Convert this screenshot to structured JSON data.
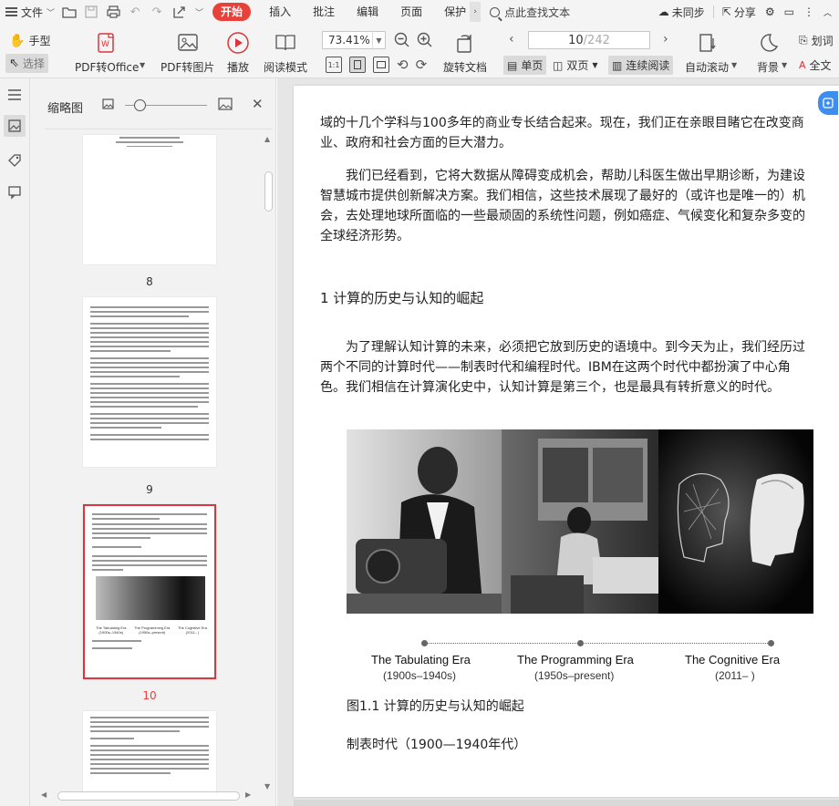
{
  "menubar": {
    "file_label": "文件",
    "tabs": [
      "开始",
      "插入",
      "批注",
      "编辑",
      "页面",
      "保护"
    ],
    "search_label": "点此查找文本",
    "sync_label": "未同步",
    "share_label": "分享"
  },
  "ribbon": {
    "hand_label": "手型",
    "select_label": "选择",
    "pdf_to_office": "PDF转Office",
    "pdf_to_image": "PDF转图片",
    "play_label": "播放",
    "read_mode": "阅读模式",
    "zoom": "73.41%",
    "page_current": "10",
    "page_total": "/242",
    "rotate_label": "旋转文档",
    "single_page": "单页",
    "double_page": "双页",
    "continuous": "连续阅读",
    "auto_scroll": "自动滚动",
    "background": "背景",
    "highlight": "划词",
    "fulltext": "全文"
  },
  "thumbnails": {
    "title": "缩略图",
    "pages": [
      {
        "num": "8",
        "selected": false
      },
      {
        "num": "9",
        "selected": false
      },
      {
        "num": "10",
        "selected": true
      }
    ],
    "thumb_era_names": [
      "The Tabulating Era",
      "The Programming Era",
      "The Cognitive Era"
    ],
    "thumb_era_years": [
      "(1900s–1940s)",
      "(1950s–present)",
      "(2011–    )"
    ]
  },
  "document": {
    "para1": "域的十几个学科与100多年的商业专长结合起来。现在，我们正在亲眼目睹它在改变商业、政府和社会方面的巨大潜力。",
    "para2": "我们已经看到，它将大数据从障碍变成机会，帮助儿科医生做出早期诊断，为建设智慧城市提供创新解决方案。我们相信，这些技术展现了最好的（或许也是唯一的）机会，去处理地球所面临的一些最顽固的系统性问题，例如癌症、气候变化和复杂多变的全球经济形势。",
    "heading": "1 计算的历史与认知的崛起",
    "para3": "为了理解认知计算的未来，必须把它放到历史的语境中。到今天为止，我们经历过两个不同的计算时代——制表时代和编程时代。IBM在这两个时代中都扮演了中心角色。我们相信在计算演化史中，认知计算是第三个，也是最具有转折意义的时代。",
    "eras": [
      {
        "name": "The Tabulating Era",
        "years": "(1900s–1940s)"
      },
      {
        "name": "The Programming Era",
        "years": "(1950s–present)"
      },
      {
        "name": "The Cognitive Era",
        "years": "(2011–      )"
      }
    ],
    "caption": "图1.1 计算的历史与认知的崛起",
    "subheading": "制表时代（1900—1940年代）"
  }
}
